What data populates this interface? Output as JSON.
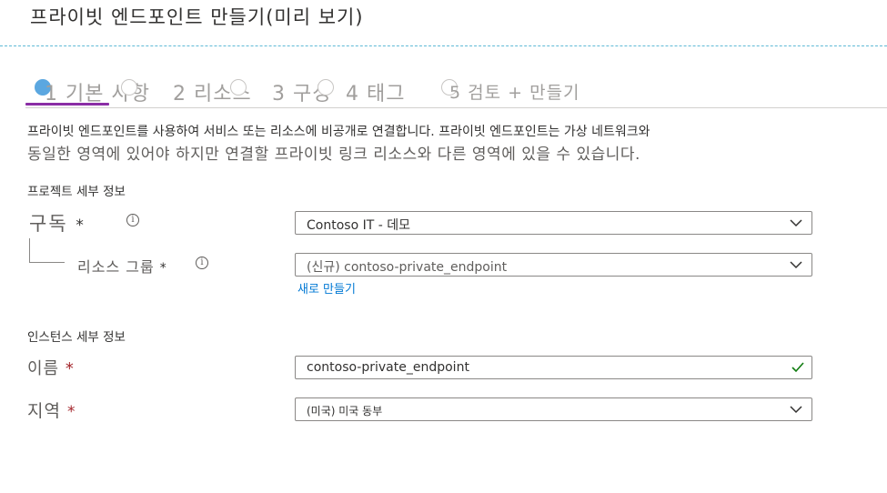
{
  "page": {
    "title": "프라이빗 엔드포인트 만들기(미리 보기)"
  },
  "tabs": [
    {
      "num": "1",
      "label": "기본 사항"
    },
    {
      "num": "2",
      "label": "리소스"
    },
    {
      "num": "3",
      "label": "구성"
    },
    {
      "num": "4",
      "label": "태그"
    },
    {
      "num": "5",
      "label": "검토 + 만들기"
    }
  ],
  "description": {
    "line1": "프라이빗 엔드포인트를 사용하여 서비스 또는 리소스에 비공개로 연결합니다. 프라이빗 엔드포인트는 가상 네트워크와",
    "line2": "동일한 영역에 있어야 하지만 연결할 프라이빗 링크 리소스와 다른 영역에 있을 수 있습니다."
  },
  "project_details": {
    "heading": "프로젝트 세부 정보",
    "subscription": {
      "label": "구독",
      "required": "*",
      "value": "Contoso IT -  데모"
    },
    "resource_group": {
      "label": "리소스 그룹",
      "required": "*",
      "value": "(신규) contoso-private_endpoint",
      "create_new": "새로 만들기"
    }
  },
  "instance_details": {
    "heading": "인스턴스 세부 정보",
    "name": {
      "label": "이름",
      "required": "*",
      "value": "contoso-private_endpoint"
    },
    "region": {
      "label": "지역",
      "required": "*",
      "value": "(미국) 미국 동부"
    }
  },
  "icons": {
    "info": "info-icon",
    "dropdown": "chevron-down-icon",
    "valid": "checkmark-icon"
  },
  "colors": {
    "accent": "#8a2da5",
    "link": "#0078d4",
    "required": "#a4262c",
    "valid": "#107c10"
  }
}
